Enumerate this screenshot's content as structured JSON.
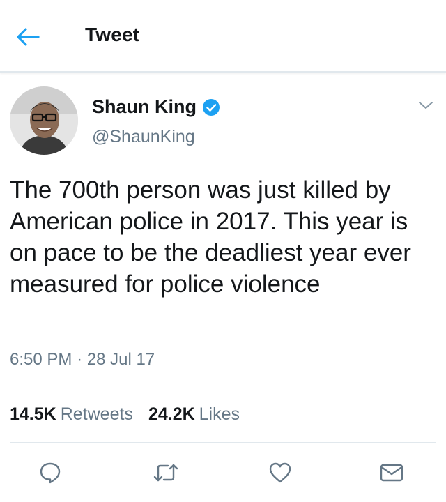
{
  "header": {
    "title": "Tweet"
  },
  "tweet": {
    "author_name": "Shaun King",
    "author_handle": "@ShaunKing",
    "verified": true,
    "text": "The 700th person was just killed by American police in 2017. This year is on pace to be the deadliest year ever measured for police violence",
    "time": "6:50 PM",
    "separator": "·",
    "date": "28 Jul 17"
  },
  "stats": {
    "retweets_count": "14.5K",
    "retweets_label": "Retweets",
    "likes_count": "24.2K",
    "likes_label": "Likes"
  },
  "icons": {
    "back": "arrow-left-icon",
    "verified": "verified-badge-icon",
    "more": "chevron-down-icon",
    "reply": "reply-icon",
    "retweet": "retweet-icon",
    "like": "heart-icon",
    "message": "envelope-icon"
  },
  "colors": {
    "accent": "#1da1f2",
    "text": "#14171a",
    "secondary": "#657786",
    "divider": "#e1e8ed"
  }
}
